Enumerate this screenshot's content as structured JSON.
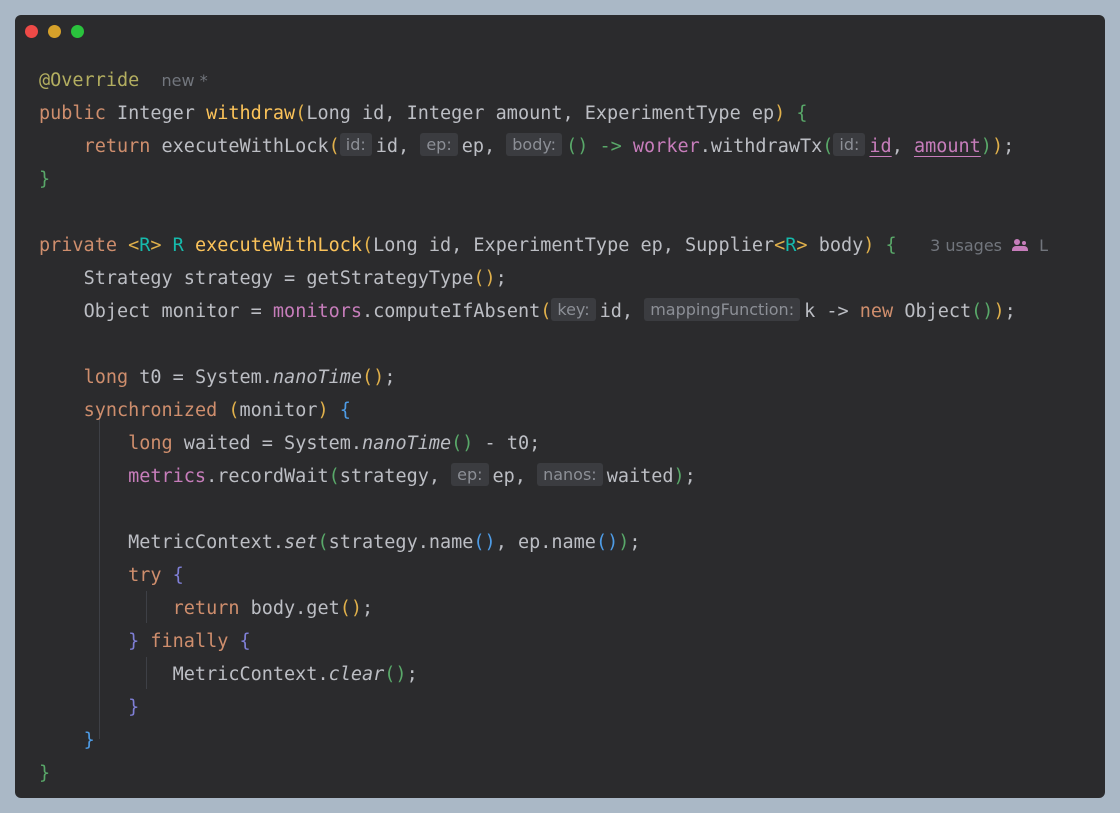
{
  "window": {
    "controls": [
      "close",
      "minimize",
      "zoom"
    ]
  },
  "code": {
    "l1_annotation": "@Override",
    "l1_meta": "new *",
    "l2_public": "public",
    "l2_type": "Integer",
    "l2_name": "withdraw",
    "l2_params": "Long id, Integer amount, ExperimentType ep",
    "l3_return": "return",
    "l3_call": "executeWithLock",
    "hint_id": "id:",
    "l3_arg_id": "id,",
    "hint_ep": "ep:",
    "l3_arg_ep": "ep,",
    "hint_body": "body:",
    "l3_lambda": "() ->",
    "l3_worker": "worker",
    "l3_method": ".withdrawTx",
    "l3_hint_id": "id:",
    "l3_id": "id",
    "l3_amount": "amount",
    "l5_private": "private",
    "l5_gen": "R",
    "l5_ret": "R",
    "l5_name": "executeWithLock",
    "l5_params_a": "Long id, ExperimentType ep, Supplier",
    "l5_params_gen": "R",
    "l5_params_b": " body",
    "l5_usages": "3 usages",
    "l5_trunc": "L",
    "l6_text": "Strategy strategy = getStrategyType",
    "l7_text_a": "Object monitor = ",
    "l7_monitors": "monitors",
    "l7_text_b": ".computeIfAbsent",
    "hint_key": "key:",
    "l7_arg_id": "id,",
    "hint_mapping": "mappingFunction:",
    "l7_lambda": "k -> ",
    "l7_new": "new",
    "l7_object": " Object",
    "l9_long": "long",
    "l9_text": " t0 = System.",
    "l9_nano": "nanoTime",
    "l10_sync": "synchronized",
    "l10_arg": "monitor",
    "l11_long": "long",
    "l11_text": " waited = System.",
    "l11_nano": "nanoTime",
    "l11_rest": " - t0;",
    "l12_metrics": "metrics",
    "l12_call": ".recordWait",
    "l12_arg_strategy": "strategy,",
    "hint_ep2": "ep:",
    "l12_arg_ep": "ep,",
    "hint_nanos": "nanos:",
    "l12_arg_waited": "waited",
    "l14_class": "MetricContext.",
    "l14_set": "set",
    "l14_a": "strategy.name",
    "l14_b": ", ep.name",
    "l15_try": "try",
    "l16_return": "return",
    "l16_text": " body.get",
    "l17_finally": "finally",
    "l18_class": "MetricContext.",
    "l18_clear": "clear"
  }
}
